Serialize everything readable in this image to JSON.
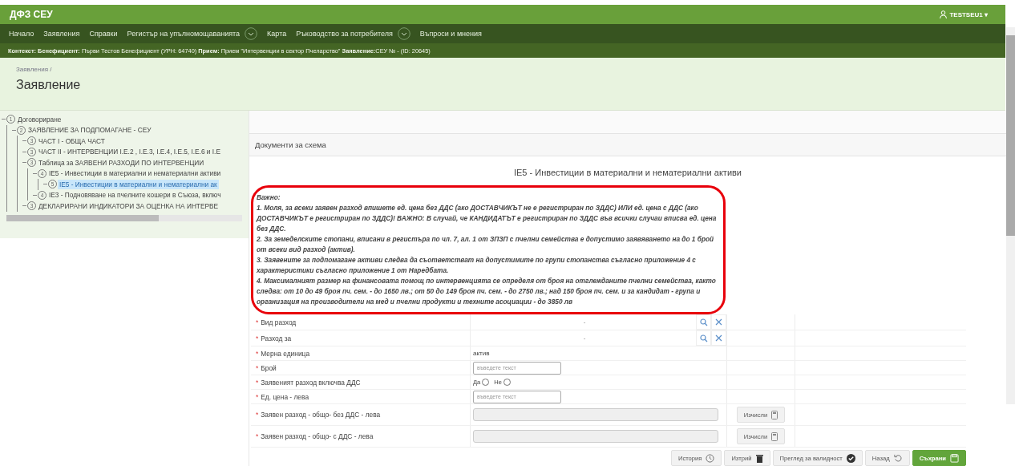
{
  "app": {
    "title": "ДФЗ СЕУ",
    "user": "TESTSEU1 ▾"
  },
  "nav": [
    {
      "label": "Начало",
      "dropdown": false
    },
    {
      "label": "Заявления",
      "dropdown": false
    },
    {
      "label": "Справки",
      "dropdown": false
    },
    {
      "label": "Регистър на упълномощаванията",
      "dropdown": true
    },
    {
      "label": "Карта",
      "dropdown": false
    },
    {
      "label": "Ръководство за потребителя",
      "dropdown": true
    },
    {
      "label": "Въпроси и мнения",
      "dropdown": false
    }
  ],
  "context": "**Контекст: Бенефициент:** Първи Тестов Бенефициент (УРН: 64740) **Прием:** Прием \"Интервенции в сектор Пчеларство\" **Заявление:**СЕУ № - (ID: 20645)",
  "breadcrumb": "Заявления /",
  "page_title": "Заявление",
  "tree": [
    {
      "num": "1",
      "label": "Договориране",
      "selected": false,
      "children": [
        {
          "num": "2",
          "label": "ЗАЯВЛЕНИЕ ЗА ПОДПОМАГАНЕ - СЕУ",
          "selected": false,
          "children": [
            {
              "num": "3",
              "label": "ЧАСТ I - ОБЩА ЧАСТ",
              "selected": false
            },
            {
              "num": "3",
              "label": "ЧАСТ II - ИНТЕРВЕНЦИИ I.E.2 , I.E.3, I.E.4, I.E.5, I.E.6 и I.E",
              "selected": false
            },
            {
              "num": "3",
              "label": "Таблица за ЗАЯВЕНИ РАЗХОДИ ПО ИНТЕРВЕНЦИИ",
              "selected": false,
              "children": [
                {
                  "num": "4",
                  "label": "IE5 - Инвестиции в материални и нематериални активи",
                  "selected": false,
                  "children": [
                    {
                      "num": "5",
                      "label": "IE5 - Инвестиции в материални и нематериални ак",
                      "selected": true
                    }
                  ]
                },
                {
                  "num": "4",
                  "label": "IE3 - Подновяване на пчелните кошери в Съюза, включ",
                  "selected": false
                }
              ]
            },
            {
              "num": "3",
              "label": "ДЕКЛАРИРАНИ ИНДИКАТОРИ ЗА ОЦЕНКА НА ИНТЕРВЕ",
              "selected": false
            }
          ]
        }
      ]
    }
  ],
  "section_title": "Документи за схема",
  "form_title": "IE5 - Инвестиции в материални и нематериални активи",
  "notice": [
    "Важно:",
    "1. Моля, за всеки заявен разход впишете ед. цена без ДДС (ако ДОСТАВЧИКЪТ не е регистриран по ЗДДС) ИЛИ ед. цена с ДДС (ако ДОСТАВЧИКЪТ е регистриран по ЗДДС)! ВАЖНО: В случай, че КАНДИДАТЪТ е регистриран по ЗДДС във всички случаи вписва ед. цена без ДДС.",
    "2. За земеделските стопани, вписани в регистъра по чл. 7, ал. 1 от ЗПЗП с пчелни семейства е допустимо заявяването на до 1 брой от всеки вид разход (актив).",
    "3. Заявените за подпомагане активи следва да съответстват на допустимите по групи стопанства съгласно приложение 4 с характеристики съгласно приложение 1 от Наредбата.",
    "4. Максималният размер на финансовата помощ по интервенцията се определя от броя на отглежданите пчелни семейства, както следва: от 10 до 49 броя пч. сем. - до 1650 лв.; от 50 до 149 броя пч. сем. - до 2750 лв.; над 150 броя пч. сем. и за кандидат - група и организация на производители на мед и пчелни продукти и техните асоциации - до 3850 лв"
  ],
  "fields": [
    {
      "kind": "lookup",
      "mark": "*",
      "label": "Вид разход",
      "value": "-"
    },
    {
      "kind": "lookup",
      "mark": "*",
      "label": "Разход за",
      "value": "-"
    },
    {
      "kind": "text",
      "mark": "*",
      "label": "Мерна единица",
      "value": "актив"
    },
    {
      "kind": "input",
      "mark": "*",
      "label": "Брой",
      "placeholder": "въведете текст"
    },
    {
      "kind": "radio",
      "mark": "*",
      "label": "Заявеният разход включва ДДС",
      "options": [
        {
          "label": "Да",
          "selected": false
        },
        {
          "label": "Не",
          "selected": false
        }
      ]
    },
    {
      "kind": "input",
      "mark": "*",
      "label": "Ед. цена - лева",
      "placeholder": "въведете текст"
    },
    {
      "kind": "calc",
      "mark": "*",
      "label": "Заявен разход - общо- без ДДС - лева",
      "button": "Изчисли"
    },
    {
      "kind": "calc",
      "mark": "*",
      "label": "Заявен разход - общо- с ДДС - лева",
      "button": "Изчисли"
    }
  ],
  "actions": [
    {
      "label": "История",
      "primary": false
    },
    {
      "label": "Изтрий",
      "primary": false
    },
    {
      "label": "Преглед за валидност",
      "primary": false
    },
    {
      "label": "Назад",
      "primary": false
    },
    {
      "label": "Съхрани",
      "primary": true
    }
  ]
}
